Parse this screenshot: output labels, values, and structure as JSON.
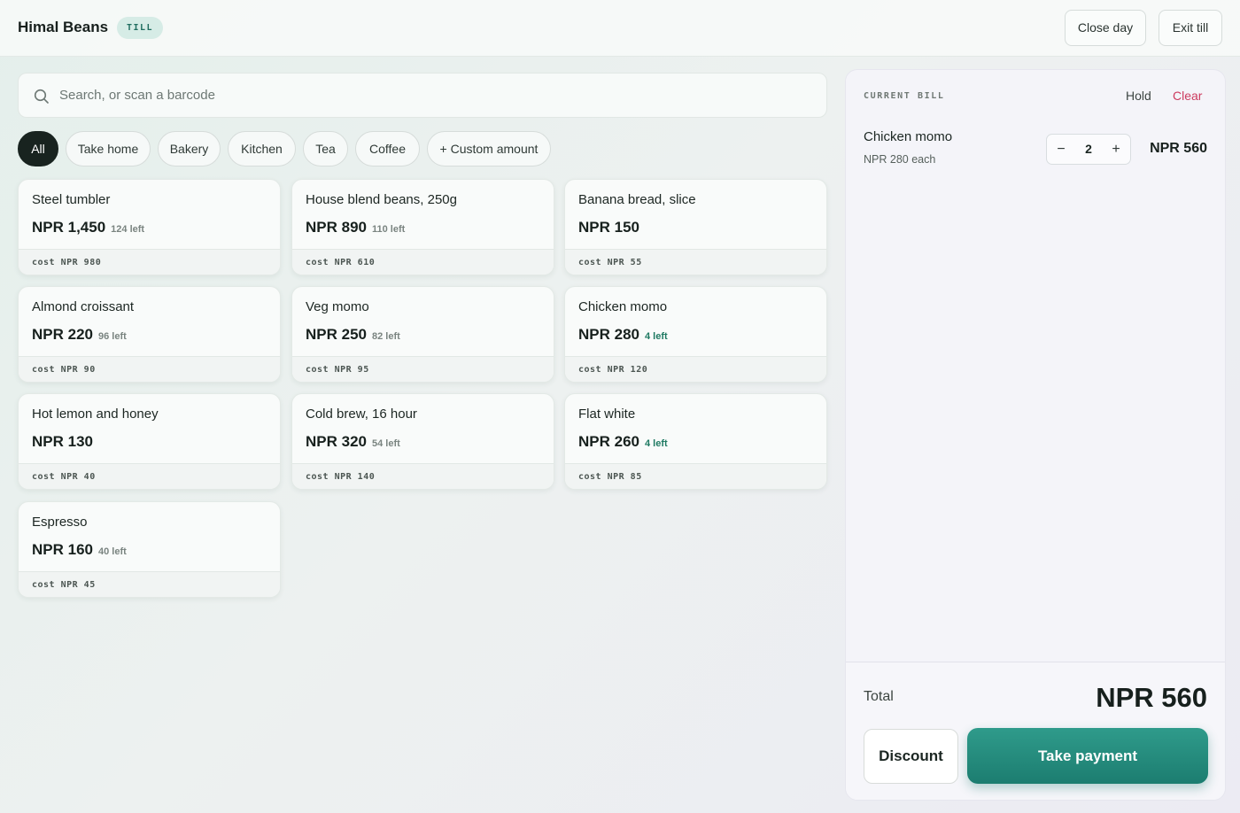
{
  "header": {
    "brand": "Himal Beans",
    "badge": "TILL",
    "close_day": "Close day",
    "exit_till": "Exit till"
  },
  "search": {
    "placeholder": "Search, or scan a barcode"
  },
  "categories": [
    "All",
    "Take home",
    "Bakery",
    "Kitchen",
    "Tea",
    "Coffee",
    "+ Custom amount"
  ],
  "active_category": "All",
  "products": [
    {
      "name": "Steel tumbler",
      "price": "NPR 1,450",
      "stock": "124 left",
      "cost": "cost NPR 980"
    },
    {
      "name": "House blend beans, 250g",
      "price": "NPR 890",
      "stock": "110 left",
      "cost": "cost NPR 610"
    },
    {
      "name": "Banana bread, slice",
      "price": "NPR 150",
      "stock": "",
      "cost": "cost NPR 55"
    },
    {
      "name": "Almond croissant",
      "price": "NPR 220",
      "stock": "96 left",
      "cost": "cost NPR 90"
    },
    {
      "name": "Veg momo",
      "price": "NPR 250",
      "stock": "82 left",
      "cost": "cost NPR 95"
    },
    {
      "name": "Chicken momo",
      "price": "NPR 280",
      "stock": "4 left",
      "cost": "cost NPR 120"
    },
    {
      "name": "Hot lemon and honey",
      "price": "NPR 130",
      "stock": "",
      "cost": "cost NPR 40"
    },
    {
      "name": "Cold brew, 16 hour",
      "price": "NPR 320",
      "stock": "54 left",
      "cost": "cost NPR 140"
    },
    {
      "name": "Flat white",
      "price": "NPR 260",
      "stock": "4 left",
      "cost": "cost NPR 85"
    },
    {
      "name": "Espresso",
      "price": "NPR 160",
      "stock": "40 left",
      "cost": "cost NPR 45"
    }
  ],
  "bill": {
    "title": "CURRENT BILL",
    "hold": "Hold",
    "clear": "Clear",
    "lines": [
      {
        "name": "Chicken momo",
        "each": "NPR 280 each",
        "qty": "2",
        "total": "NPR 560"
      }
    ],
    "total_label": "Total",
    "total_value": "NPR 560",
    "discount": "Discount",
    "take_payment": "Take payment"
  },
  "colors": {
    "accent": "#1f8a7a",
    "low_stock": "#1f7a62",
    "clear": "#cc3b5f",
    "active_chip": "#18231f"
  }
}
